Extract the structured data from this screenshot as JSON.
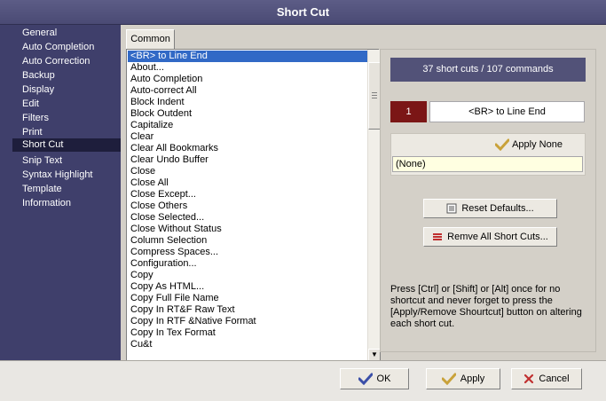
{
  "window": {
    "title": "Short Cut"
  },
  "sidebar": {
    "items": [
      {
        "label": "General"
      },
      {
        "label": "Auto Completion"
      },
      {
        "label": "Auto Correction"
      },
      {
        "label": "Backup"
      },
      {
        "label": "Display"
      },
      {
        "label": "Edit"
      },
      {
        "label": "Filters"
      },
      {
        "label": "Print"
      },
      {
        "label": "Short Cut"
      },
      {
        "label": "Snip Text"
      },
      {
        "label": "Syntax Highlight"
      },
      {
        "label": "Template"
      },
      {
        "label": "Information"
      }
    ],
    "selected": "Short Cut"
  },
  "tabs": [
    {
      "label": "Common"
    }
  ],
  "command_list": {
    "items": [
      "<BR> to Line End",
      "About...",
      "Auto Completion",
      "Auto-correct All",
      "Block Indent",
      "Block Outdent",
      "Capitalize",
      "Clear",
      "Clear All Bookmarks",
      "Clear Undo Buffer",
      "Close",
      "Close All",
      "Close Except...",
      "Close Others",
      "Close Selected...",
      "Close Without Status",
      "Column Selection",
      "Compress Spaces...",
      "Configuration...",
      "Copy",
      "Copy As HTML...",
      "Copy Full File Name",
      "Copy In RT&F Raw Text",
      "Copy In RTF &Native Format",
      "Copy In Tex Format",
      "Cu&t"
    ],
    "selected_index": 0
  },
  "summary": {
    "text": "37 short cuts / 107 commands"
  },
  "selected_command": {
    "number": "1",
    "name": "<BR> to Line End"
  },
  "shortcut": {
    "apply_none_label": "Apply None",
    "value": "(None)"
  },
  "actions": {
    "reset_defaults_label": "Reset Defaults...",
    "remove_all_label": "Remve All Short Cuts..."
  },
  "help": {
    "text": "Press [Ctrl] or [Shift] or [Alt] once for no shortcut and never forget to press the [Apply/Remove Shourtcut] button on altering each short cut."
  },
  "dialog": {
    "ok_label": "OK",
    "apply_label": "Apply",
    "cancel_label": "Cancel"
  },
  "colors": {
    "title_bar": "#4f4f79",
    "sidebar_bg": "#3f3f6b",
    "selection": "#3169c6",
    "summary_bg": "#525278",
    "number_bg": "#7b1616"
  }
}
